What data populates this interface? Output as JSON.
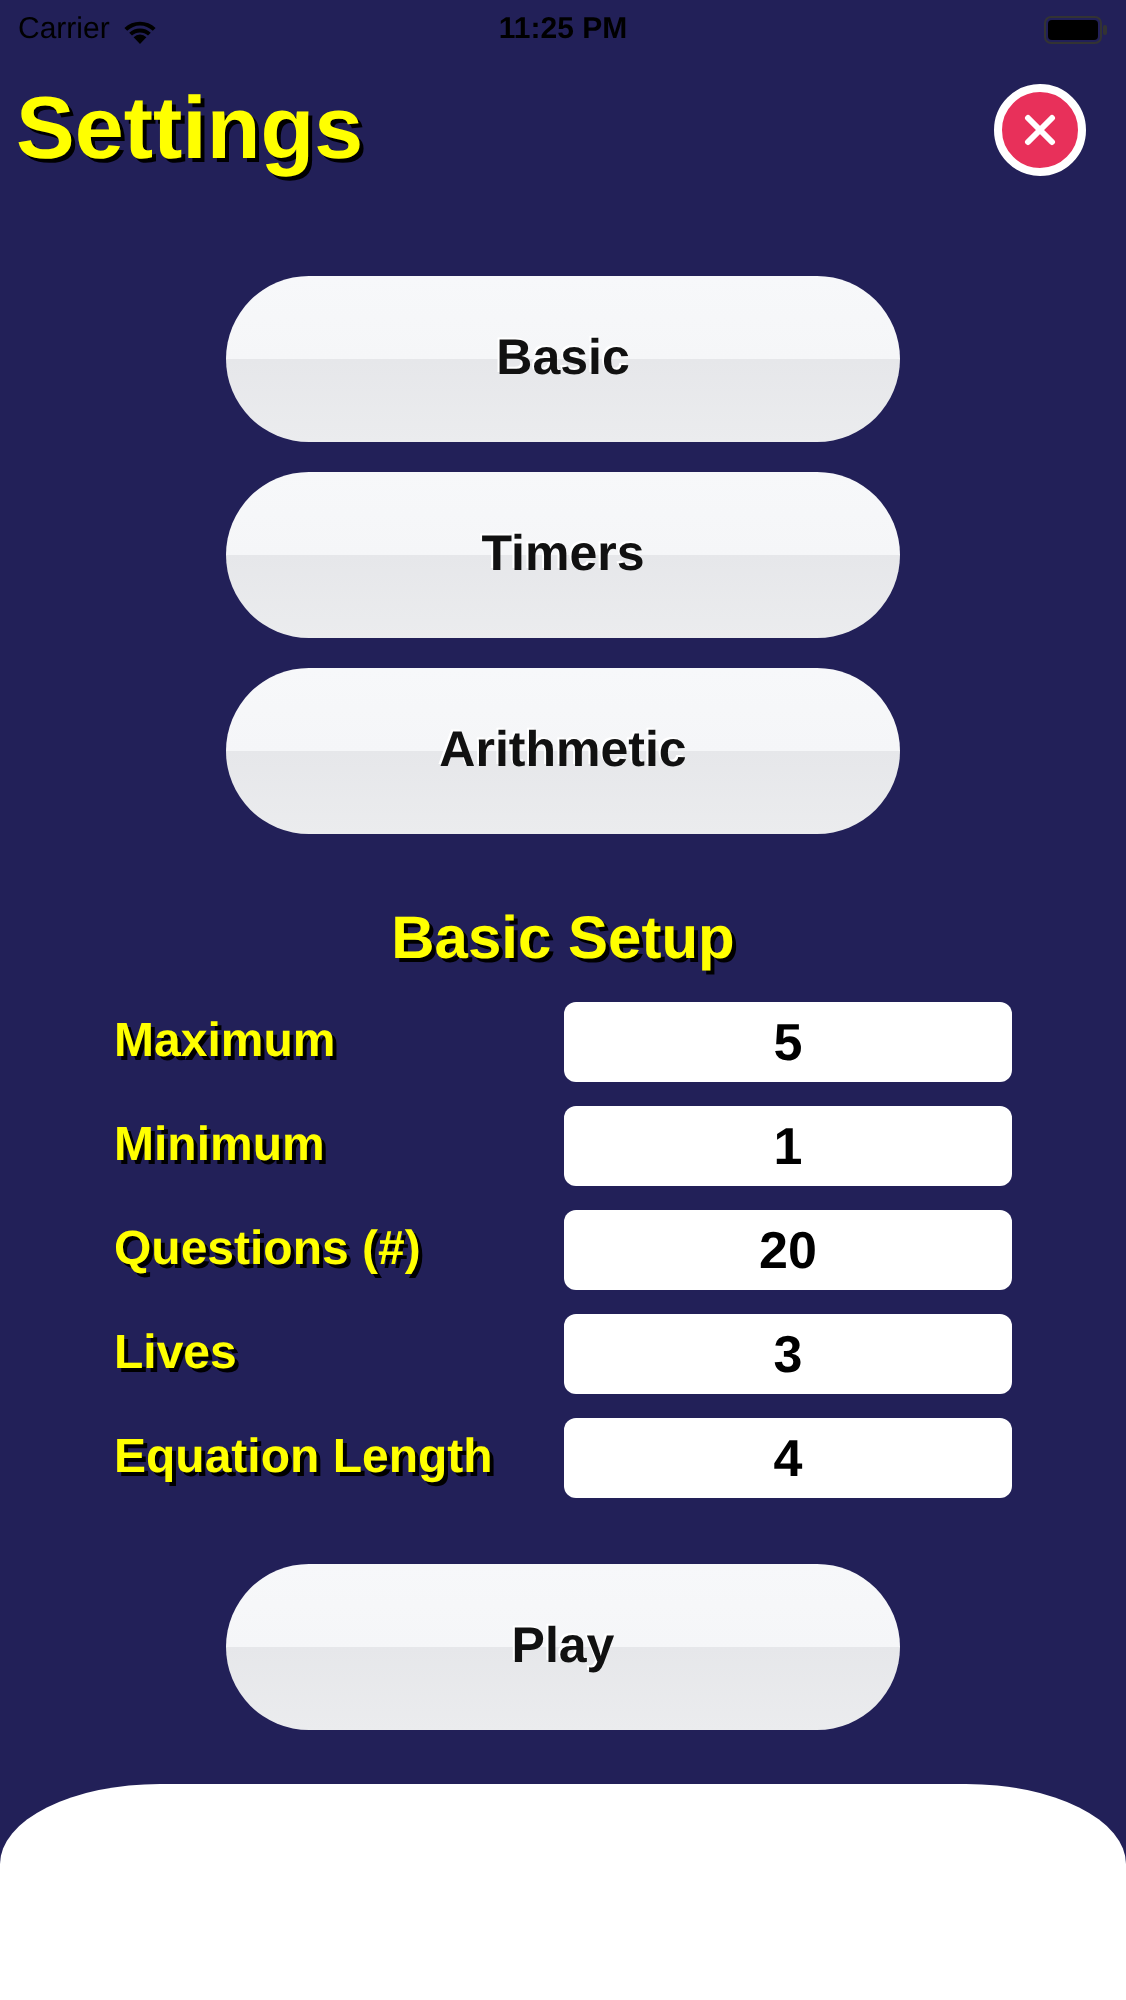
{
  "status_bar": {
    "carrier": "Carrier",
    "time": "11:25 PM"
  },
  "header": {
    "title": "Settings"
  },
  "tabs": [
    {
      "label": "Basic"
    },
    {
      "label": "Timers"
    },
    {
      "label": "Arithmetic"
    }
  ],
  "section": {
    "title": "Basic Setup",
    "fields": [
      {
        "label": "Maximum",
        "value": "5"
      },
      {
        "label": "Minimum",
        "value": "1"
      },
      {
        "label": "Questions (#)",
        "value": "20"
      },
      {
        "label": "Lives",
        "value": "3"
      },
      {
        "label": "Equation Length",
        "value": "4"
      }
    ]
  },
  "play_button": {
    "label": "Play"
  }
}
